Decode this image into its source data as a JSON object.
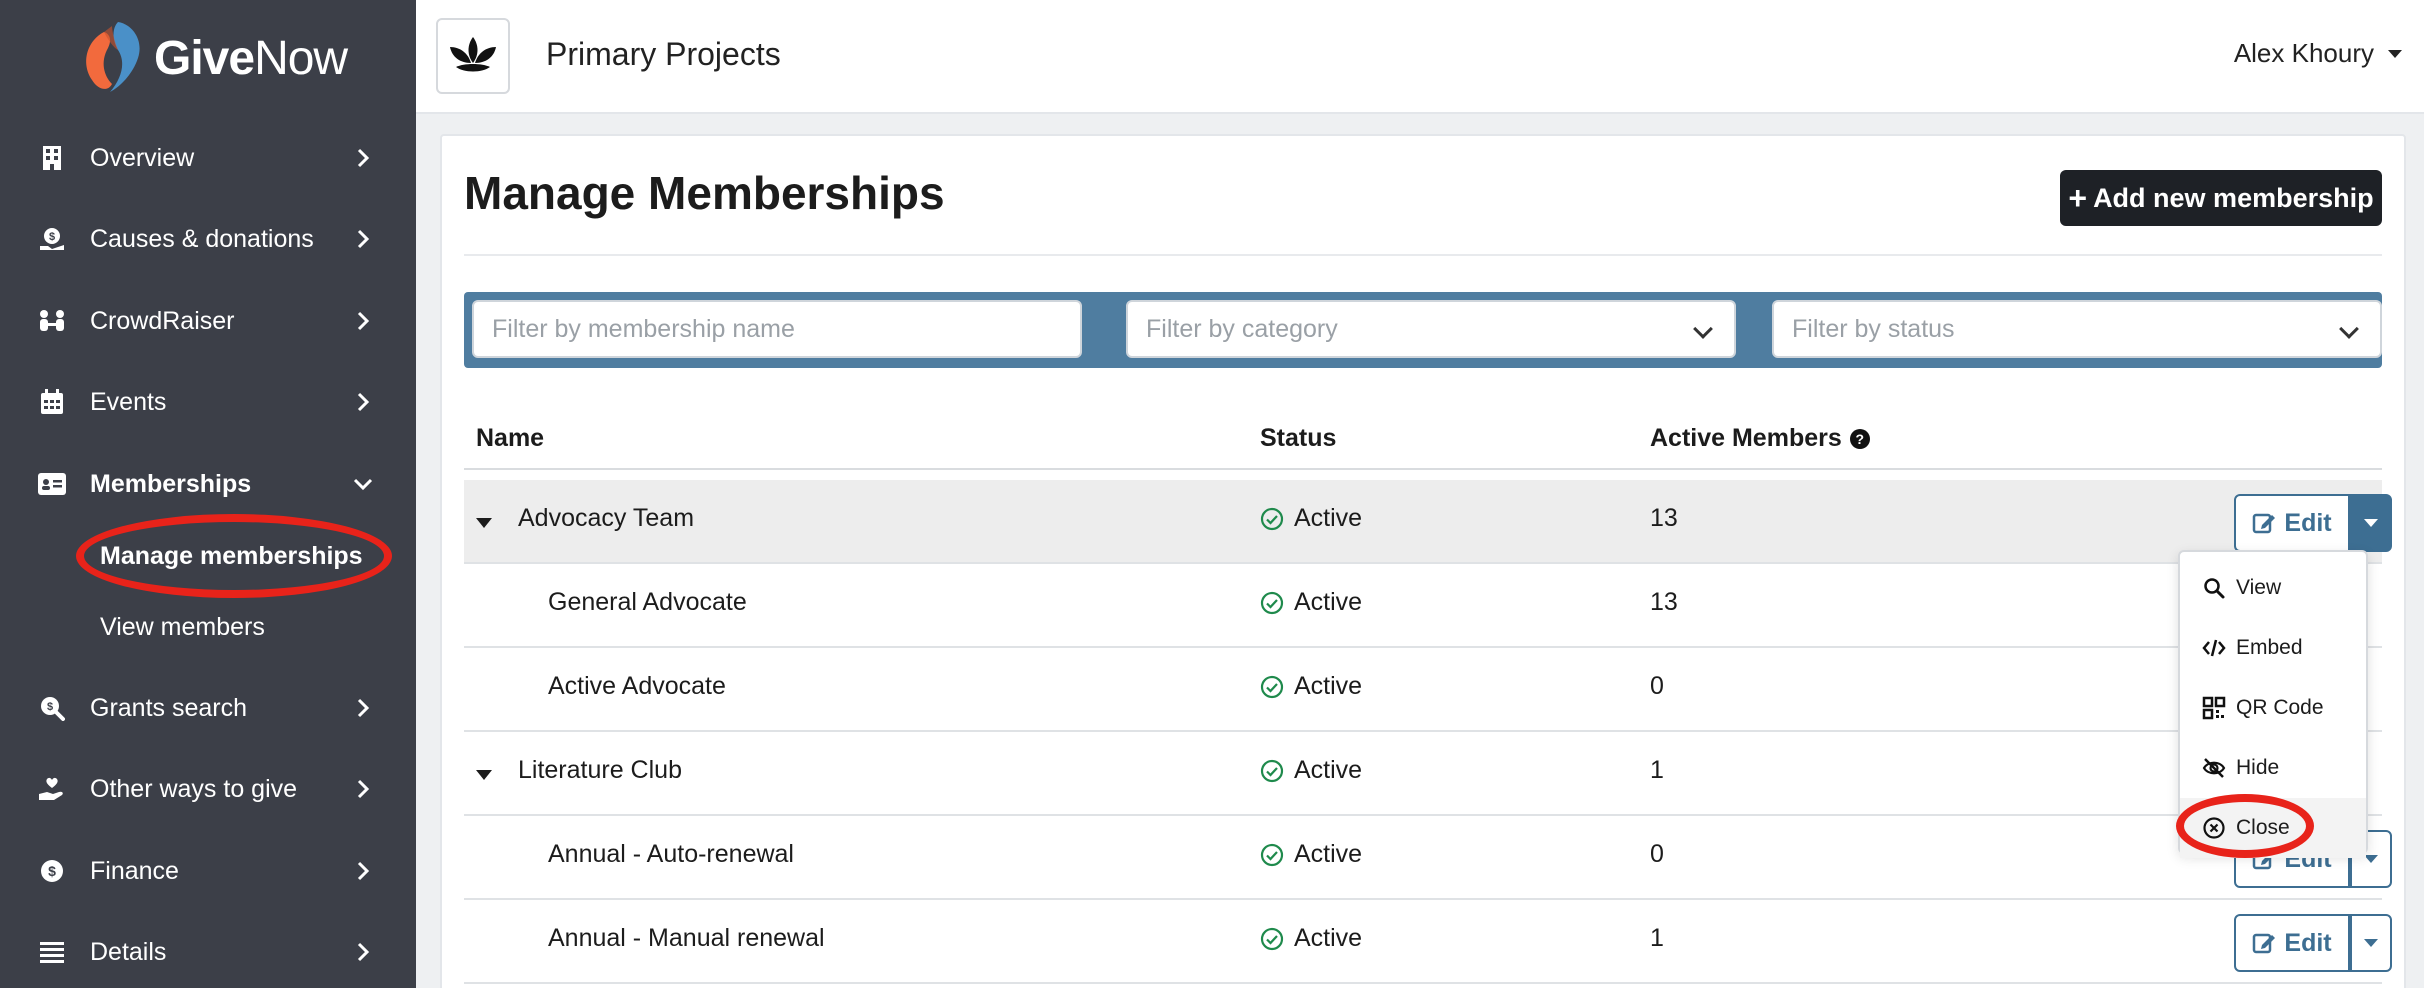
{
  "brand": {
    "name_part1": "Give",
    "name_part2": "Now"
  },
  "sidebar": {
    "items": [
      {
        "label": "Overview",
        "icon": "building-icon"
      },
      {
        "label": "Causes & donations",
        "icon": "donation-icon"
      },
      {
        "label": "CrowdRaiser",
        "icon": "people-icon"
      },
      {
        "label": "Events",
        "icon": "calendar-icon"
      },
      {
        "label": "Memberships",
        "icon": "id-card-icon"
      },
      {
        "label": "Grants search",
        "icon": "grant-search-icon"
      },
      {
        "label": "Other ways to give",
        "icon": "hand-heart-icon"
      },
      {
        "label": "Finance",
        "icon": "finance-icon"
      },
      {
        "label": "Details",
        "icon": "list-icon"
      }
    ],
    "sub_items": [
      {
        "label": "Manage memberships"
      },
      {
        "label": "View members"
      }
    ]
  },
  "topbar": {
    "org_name": "Primary Projects",
    "user_name": "Alex Khoury"
  },
  "page": {
    "title": "Manage Memberships",
    "add_button": "Add new membership"
  },
  "filters": {
    "name_placeholder": "Filter by membership name",
    "category_placeholder": "Filter by category",
    "status_placeholder": "Filter by status"
  },
  "table": {
    "headers": {
      "name": "Name",
      "status": "Status",
      "active_members": "Active Members"
    },
    "rows": [
      {
        "name": "Advocacy Team",
        "status": "Active",
        "active_members": "13",
        "group": true
      },
      {
        "name": "General Advocate",
        "status": "Active",
        "active_members": "13",
        "group": false
      },
      {
        "name": "Active Advocate",
        "status": "Active",
        "active_members": "0",
        "group": false
      },
      {
        "name": "Literature Club",
        "status": "Active",
        "active_members": "1",
        "group": true
      },
      {
        "name": "Annual - Auto-renewal",
        "status": "Active",
        "active_members": "0",
        "group": false
      },
      {
        "name": "Annual - Manual renewal",
        "status": "Active",
        "active_members": "1",
        "group": false
      }
    ],
    "edit_label": "Edit"
  },
  "dropdown_menu": {
    "items": [
      {
        "label": "View",
        "icon": "search-icon"
      },
      {
        "label": "Embed",
        "icon": "code-icon"
      },
      {
        "label": "QR Code",
        "icon": "qr-code-icon"
      },
      {
        "label": "Hide",
        "icon": "eye-slash-icon"
      },
      {
        "label": "Close",
        "icon": "close-circle-icon"
      }
    ]
  },
  "colors": {
    "sidebar_bg": "#3c3f48",
    "primary_blue": "#3d6e92",
    "filter_bar": "#4f7da0",
    "status_green": "#1f8a4c",
    "highlight_red": "#e8231a",
    "logo_orange": "#f26a3d",
    "logo_blue": "#4a90c8"
  }
}
